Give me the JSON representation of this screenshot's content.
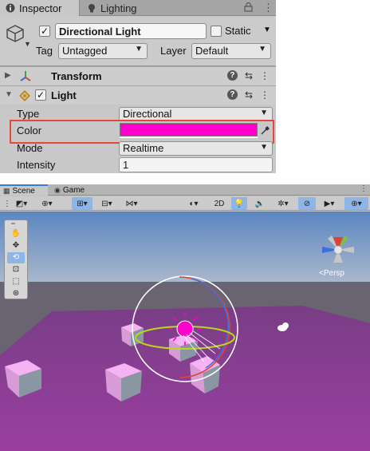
{
  "inspector": {
    "tabs": {
      "inspector": "Inspector",
      "lighting": "Lighting"
    },
    "object": {
      "name": "Directional Light",
      "static_label": "Static",
      "tag_label": "Tag",
      "tag_value": "Untagged",
      "layer_label": "Layer",
      "layer_value": "Default"
    },
    "components": {
      "transform": "Transform",
      "light": "Light"
    },
    "properties": {
      "type_label": "Type",
      "type_value": "Directional",
      "color_label": "Color",
      "mode_label": "Mode",
      "mode_value": "Realtime",
      "intensity_label": "Intensity",
      "intensity_value": "1"
    },
    "colors": {
      "light_color": "#ff00cc",
      "highlight": "#e8463c"
    }
  },
  "scene": {
    "tabs": {
      "scene": "Scene",
      "game": "Game"
    },
    "toolbar": {
      "mode_2d": "2D"
    },
    "persp_label": "<Persp",
    "colors": {
      "sky_top": "#5b86c0",
      "ground": "#8a3e8f",
      "cube": "#f2a6f0"
    }
  }
}
